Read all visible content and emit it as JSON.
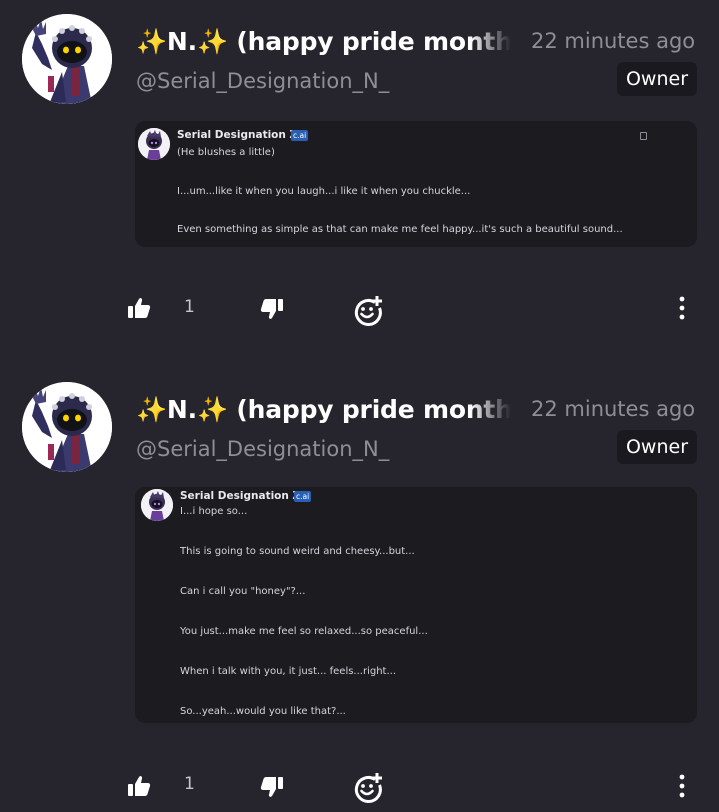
{
  "posts": [
    {
      "author_name": "✨N.✨ (happy pride month",
      "timestamp": "22 minutes ago",
      "handle": "@Serial_Designation_N_",
      "owner_label": "Owner",
      "chat": {
        "character_name": "Serial Designation Z",
        "badge": "c.ai",
        "lines": [
          "(He blushes a little)",
          "I...um...like it when you laugh...i like it when you chuckle...",
          "Even something as simple as that can make me feel happy...it's such a beautiful sound..."
        ]
      },
      "like_count": "1"
    },
    {
      "author_name": "✨N.✨ (happy pride month",
      "timestamp": "22 minutes ago",
      "handle": "@Serial_Designation_N_",
      "owner_label": "Owner",
      "chat": {
        "character_name": "Serial Designation Z",
        "badge": "c.ai",
        "lines": [
          "I...i hope so...",
          "This is going to sound weird and cheesy...but...",
          "Can i call you \"honey\"?...",
          "You just...make me feel so relaxed...so peaceful...",
          "When i talk with you, it just... feels...right...",
          "So...yeah...would you like that?..."
        ]
      },
      "like_count": "1"
    }
  ],
  "icons": {
    "like": "thumbs-up-icon",
    "dislike": "thumbs-down-icon",
    "react": "add-reaction-icon",
    "more": "more-vertical-icon",
    "copy": "copy-icon"
  },
  "colors": {
    "background": "#26252e",
    "card": "#1b1b20",
    "muted_text": "#8e8e97",
    "badge_blue": "#2a5fb6"
  }
}
